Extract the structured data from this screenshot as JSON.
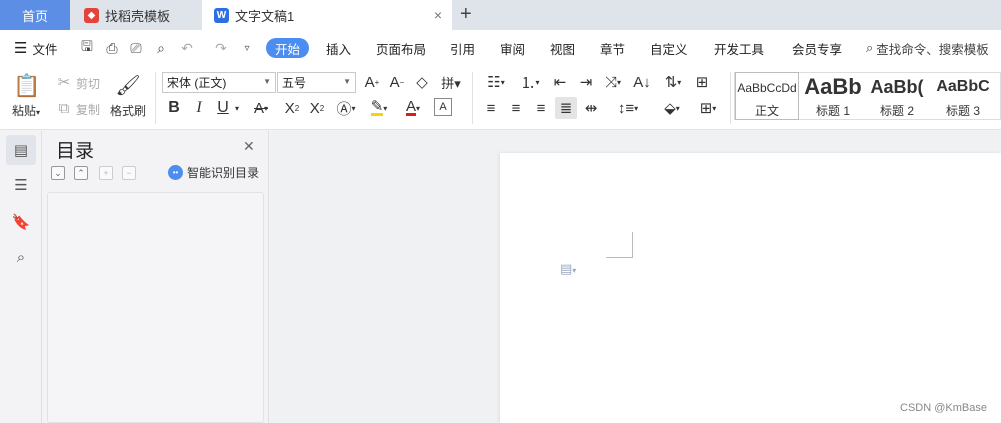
{
  "tabs": {
    "home": "首页",
    "find_template": "找稻壳模板",
    "document": "文字文稿1",
    "close": "×",
    "add": "+"
  },
  "menu": {
    "file": "文件",
    "items": [
      "开始",
      "插入",
      "页面布局",
      "引用",
      "审阅",
      "视图",
      "章节",
      "自定义",
      "开发工具",
      "会员专享"
    ],
    "search": "查找命令、搜索模板"
  },
  "ribbon": {
    "paste": "粘贴",
    "cut": "剪切",
    "copy": "复制",
    "format_painter": "格式刷",
    "font_name": "宋体 (正文)",
    "font_size": "五号",
    "bold": "B",
    "italic": "I",
    "underline": "U",
    "styles": [
      {
        "sample": "AaBbCcDd",
        "name": "正文"
      },
      {
        "sample": "AaBb",
        "name": "标题 1"
      },
      {
        "sample": "AaBb(",
        "name": "标题 2"
      },
      {
        "sample": "AaBbC",
        "name": "标题 3"
      }
    ]
  },
  "toc": {
    "title": "目录",
    "smart_recognize": "智能识别目录"
  },
  "watermark": "CSDN @KmBase",
  "colors": {
    "accent": "#4b8df0",
    "home_tab": "#5d8ee6",
    "highlight": "#f5d50a",
    "font_color": "#d61f1f"
  }
}
